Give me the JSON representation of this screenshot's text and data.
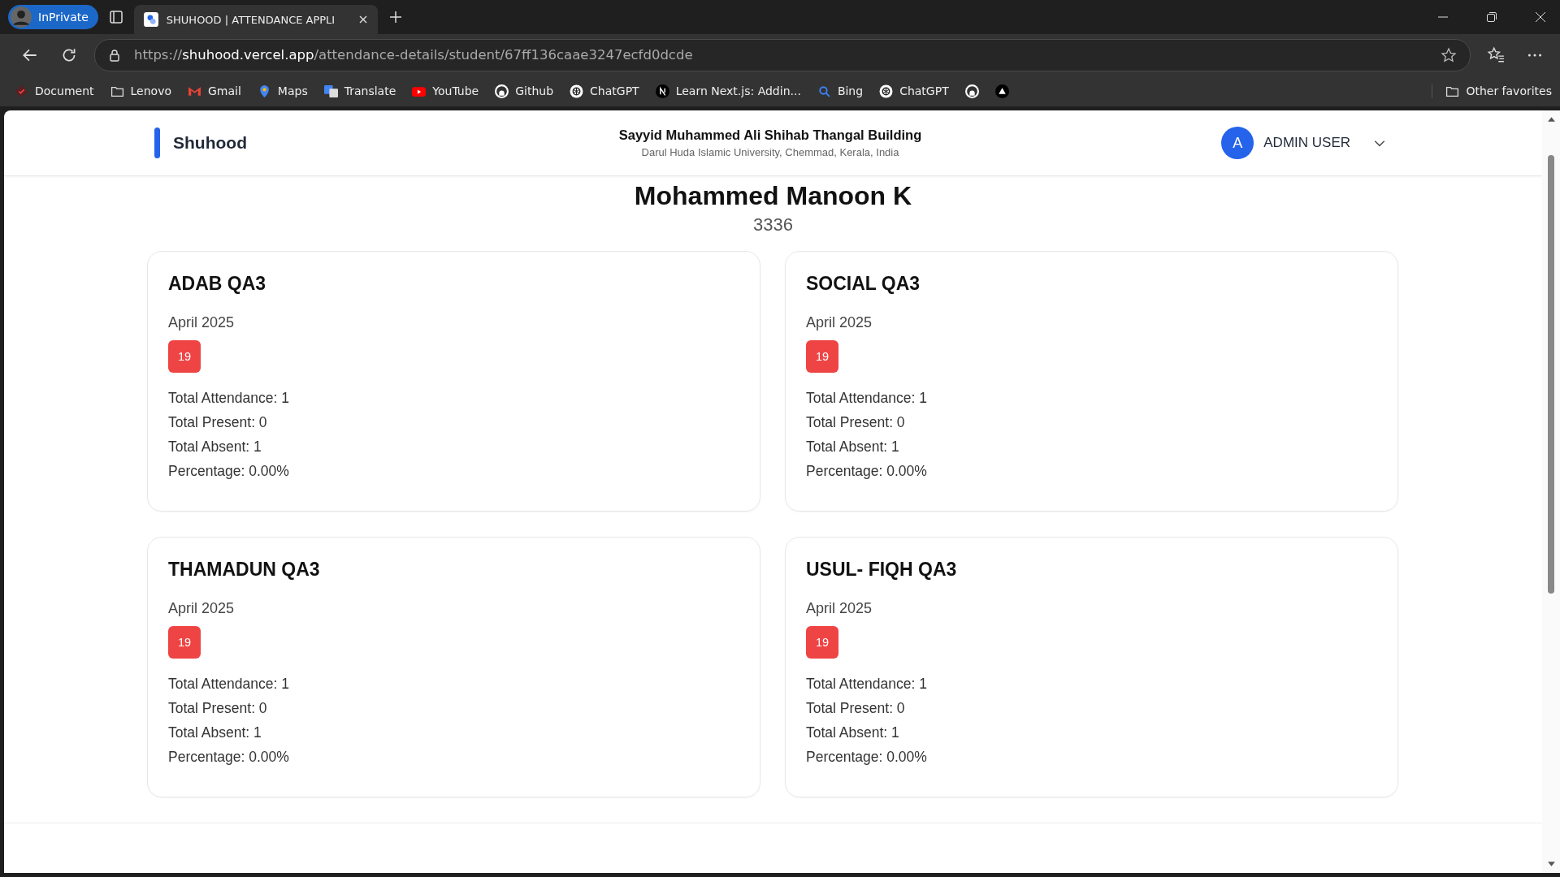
{
  "browser": {
    "profile": "InPrivate",
    "tab_title": "SHUHOOD | ATTENDANCE APPLI",
    "url_scheme": "https://",
    "url_host": "shuhood.vercel.app",
    "url_path": "/attendance-details/student/67ff136caae3247ecfd0dcde",
    "bookmarks": [
      {
        "kind": "check",
        "label": "Document"
      },
      {
        "kind": "folder",
        "label": "Lenovo"
      },
      {
        "kind": "mail",
        "label": "Gmail"
      },
      {
        "kind": "pin",
        "label": "Maps"
      },
      {
        "kind": "translate",
        "label": "Translate"
      },
      {
        "kind": "video",
        "label": "YouTube"
      },
      {
        "kind": "github",
        "label": "Github"
      },
      {
        "kind": "chatgpt",
        "label": "ChatGPT"
      },
      {
        "kind": "next",
        "label": "Learn Next.js: Addin..."
      },
      {
        "kind": "search",
        "label": "Bing"
      },
      {
        "kind": "chatgpt",
        "label": "ChatGPT"
      },
      {
        "kind": "github"
      },
      {
        "kind": "triangle"
      }
    ],
    "other_favorites": "Other favorites"
  },
  "header": {
    "brand": "Shuhood",
    "building": "Sayyid Muhammed Ali Shihab Thangal Building",
    "address": "Darul Huda Islamic University, Chemmad, Kerala, India",
    "avatar_letter": "A",
    "user": "ADMIN USER"
  },
  "student": {
    "name": "Mohammed Manoon K",
    "number": "3336"
  },
  "subjects": [
    {
      "title": "ADAB QA3",
      "month": "April 2025",
      "days": [
        {
          "day": "19",
          "present": false
        }
      ],
      "stats": [
        "Total Attendance: 1",
        "Total Present: 0",
        "Total Absent: 1",
        "Percentage: 0.00%"
      ]
    },
    {
      "title": "SOCIAL QA3",
      "month": "April 2025",
      "days": [
        {
          "day": "19",
          "present": false
        }
      ],
      "stats": [
        "Total Attendance: 1",
        "Total Present: 0",
        "Total Absent: 1",
        "Percentage: 0.00%"
      ]
    },
    {
      "title": "THAMADUN QA3",
      "month": "April 2025",
      "days": [
        {
          "day": "19",
          "present": false
        }
      ],
      "stats": [
        "Total Attendance: 1",
        "Total Present: 0",
        "Total Absent: 1",
        "Percentage: 0.00%"
      ]
    },
    {
      "title": "USUL- FIQH QA3",
      "month": "April 2025",
      "days": [
        {
          "day": "19",
          "present": false
        }
      ],
      "stats": [
        "Total Attendance: 1",
        "Total Present: 0",
        "Total Absent: 1",
        "Percentage: 0.00%"
      ]
    }
  ]
}
